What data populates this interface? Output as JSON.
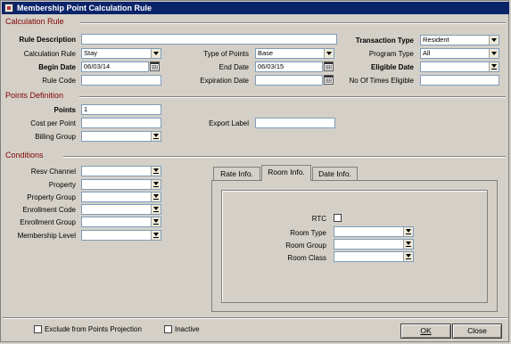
{
  "window": {
    "title": "Membership Point Calculation Rule"
  },
  "sections": {
    "calculation_rule": "Calculation Rule",
    "points_definition": "Points Definition",
    "conditions": "Conditions"
  },
  "calc": {
    "rule_description": {
      "label": "Rule Description",
      "value": ""
    },
    "calculation_rule": {
      "label": "Calculation Rule",
      "value": "Stay"
    },
    "begin_date": {
      "label": "Begin Date",
      "value": "06/03/14"
    },
    "rule_code": {
      "label": "Rule Code",
      "value": ""
    },
    "type_of_points": {
      "label": "Type of Points",
      "value": "Base"
    },
    "end_date": {
      "label": "End Date",
      "value": "06/03/15"
    },
    "expiration_date": {
      "label": "Expiration Date",
      "value": ""
    },
    "transaction_type": {
      "label": "Transaction Type",
      "value": "Resident"
    },
    "program_type": {
      "label": "Program Type",
      "value": "All"
    },
    "eligible_date": {
      "label": "Eligible Date",
      "value": ""
    },
    "no_of_times_eligible": {
      "label": "No Of Times Eligible",
      "value": ""
    }
  },
  "points": {
    "points": {
      "label": "Points",
      "value": "1"
    },
    "cost_per_point": {
      "label": "Cost per Point",
      "value": ""
    },
    "billing_group": {
      "label": "Billing Group",
      "value": ""
    },
    "export_label": {
      "label": "Export Label",
      "value": ""
    }
  },
  "conditions": {
    "resv_channel": "Resv Channel",
    "property": "Property",
    "property_group": "Property Group",
    "enrollment_code": "Enrollment Code",
    "enrollment_group": "Enrollment Group",
    "membership_level": "Membership Level"
  },
  "tabs": [
    "Rate Info.",
    "Room Info.",
    "Date Info."
  ],
  "active_tab": "Room Info.",
  "room_info": {
    "rtc": "RTC",
    "room_type": "Room Type",
    "room_group": "Room Group",
    "room_class": "Room Class"
  },
  "footer": {
    "exclude_label": "Exclude from Points Projection",
    "inactive_label": "Inactive",
    "ok_label": "OK",
    "close_label": "Close"
  }
}
